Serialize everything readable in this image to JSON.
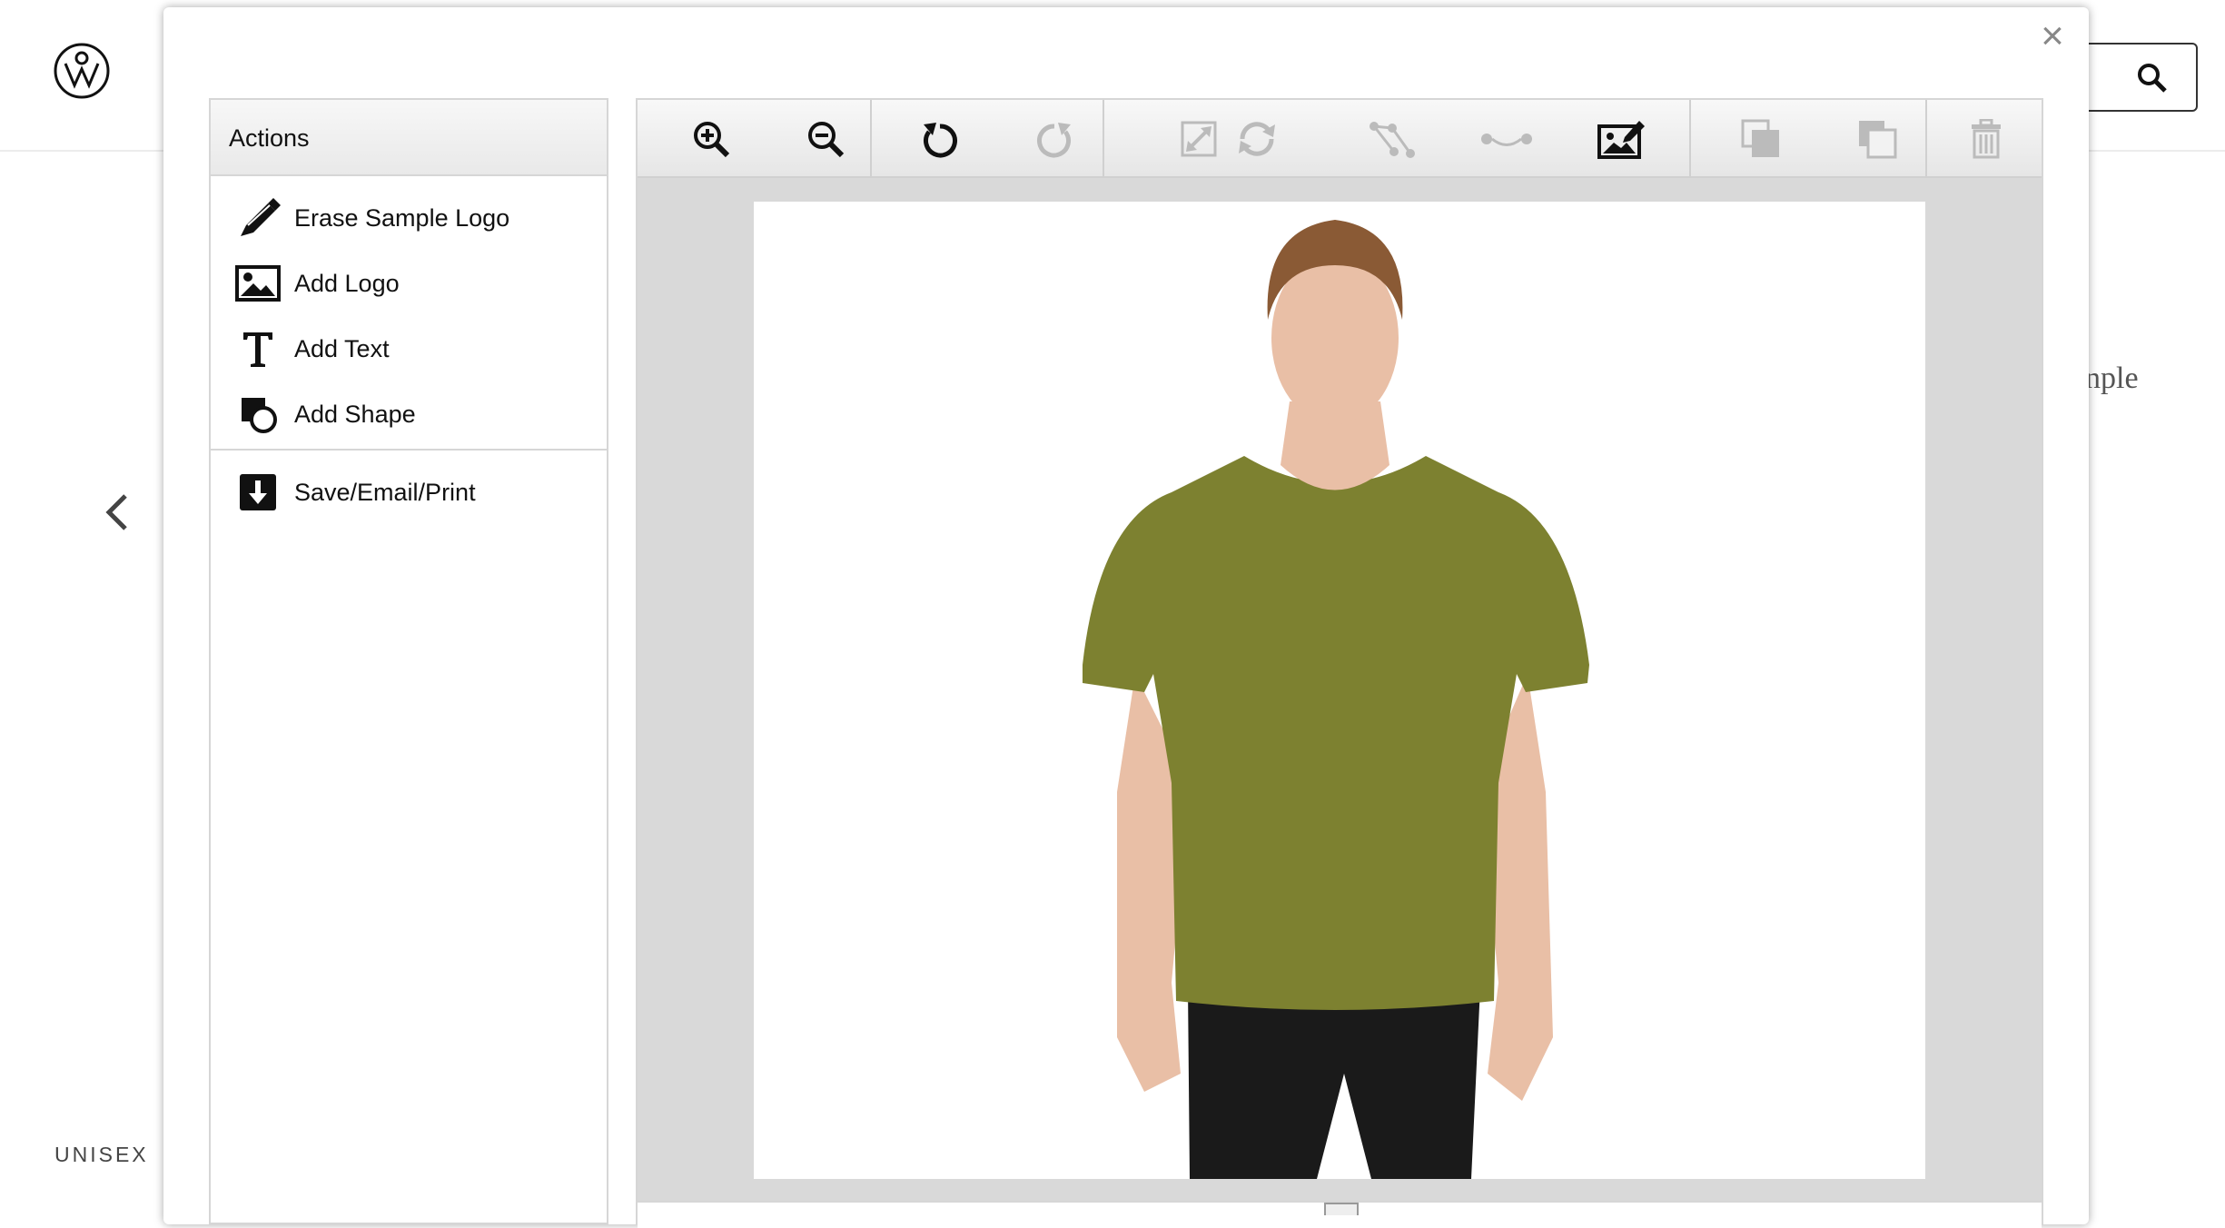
{
  "background": {
    "category_label": "UNISEX",
    "partial_text": "nple"
  },
  "modal": {
    "close_label": "×"
  },
  "actions": {
    "header": "Actions",
    "items": [
      {
        "label": "Erase Sample Logo",
        "icon": "marker-icon"
      },
      {
        "label": "Add Logo",
        "icon": "image-icon"
      },
      {
        "label": "Add Text",
        "icon": "text-icon"
      },
      {
        "label": "Add Shape",
        "icon": "shape-icon"
      }
    ],
    "save_item": {
      "label": "Save/Email/Print",
      "icon": "download-icon"
    }
  },
  "toolbar": {
    "buttons": [
      {
        "name": "zoom-in-icon",
        "enabled": true
      },
      {
        "name": "zoom-out-icon",
        "enabled": true
      },
      {
        "name": "undo-icon",
        "enabled": true
      },
      {
        "name": "redo-icon",
        "enabled": false
      },
      {
        "name": "resize-icon",
        "enabled": false
      },
      {
        "name": "rotate-icon",
        "enabled": false
      },
      {
        "name": "nodes-icon",
        "enabled": false
      },
      {
        "name": "curve-icon",
        "enabled": false
      },
      {
        "name": "edit-image-icon",
        "enabled": true
      },
      {
        "name": "bring-forward-icon",
        "enabled": false
      },
      {
        "name": "send-backward-icon",
        "enabled": false
      },
      {
        "name": "trash-icon",
        "enabled": false
      }
    ]
  },
  "canvas": {
    "shirt_color": "#7d8130",
    "pants_color": "#1a1a1a",
    "skin_color": "#e9bfa6",
    "hair_color": "#8a5a35"
  }
}
